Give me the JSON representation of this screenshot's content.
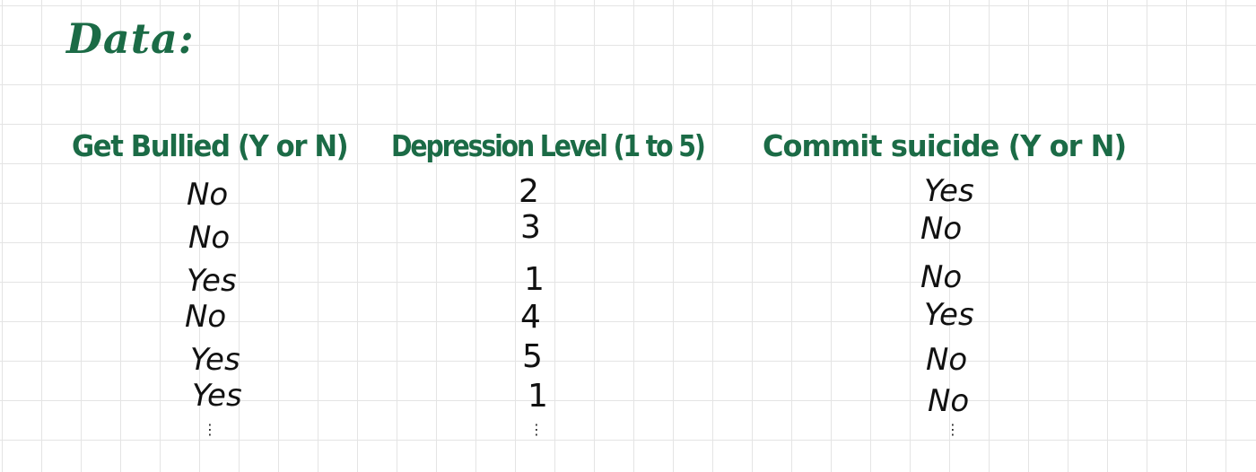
{
  "heading": "Data:",
  "columns": [
    {
      "header": "Get Bullied (Y or N)",
      "values": [
        "No",
        "No",
        "Yes",
        "No",
        "Yes",
        "Yes"
      ]
    },
    {
      "header": "Depression Level (1 to 5)",
      "values": [
        "2",
        "3",
        "1",
        "4",
        "5",
        "1"
      ]
    },
    {
      "header": "Commit suicide (Y or N)",
      "values": [
        "Yes",
        "No",
        "No",
        "Yes",
        "No",
        "No"
      ]
    }
  ],
  "ellipsis": "⋮",
  "colors": {
    "ink_green": "#1b6b46",
    "ink_black": "#111111",
    "grid_line": "#e4e4e4",
    "paper": "#ffffff"
  }
}
